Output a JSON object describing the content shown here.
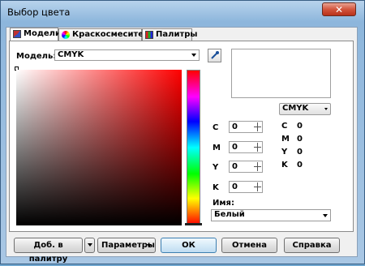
{
  "window": {
    "title": "Выбор цвета",
    "close_glyph": "✕"
  },
  "tabs": [
    {
      "label": "Модели",
      "icon": "models-icon",
      "active": true
    },
    {
      "label": "Краскосмесители",
      "icon": "mixers-icon",
      "active": false
    },
    {
      "label": "Палитры",
      "icon": "palettes-icon",
      "active": false
    }
  ],
  "model": {
    "label": "Модель:",
    "value": "CMYK"
  },
  "color_model_dropdown": {
    "value": "CMYK"
  },
  "cmyk_inputs": [
    {
      "label": "C",
      "value": "0"
    },
    {
      "label": "M",
      "value": "0"
    },
    {
      "label": "Y",
      "value": "0"
    },
    {
      "label": "K",
      "value": "0"
    }
  ],
  "cmyk_readout": [
    {
      "label": "C",
      "value": "0"
    },
    {
      "label": "M",
      "value": "0"
    },
    {
      "label": "Y",
      "value": "0"
    },
    {
      "label": "K",
      "value": "0"
    }
  ],
  "name": {
    "label": "Имя:",
    "value": "Белый"
  },
  "buttons": {
    "add_to_palette": "Доб. в палитру",
    "parameters": "Параметры",
    "ok": "ОК",
    "cancel": "Отмена",
    "help": "Справка"
  },
  "colors": {
    "hue_base": "#ff0000",
    "title_bar": "#8db6dc",
    "close": "#c8412a"
  }
}
